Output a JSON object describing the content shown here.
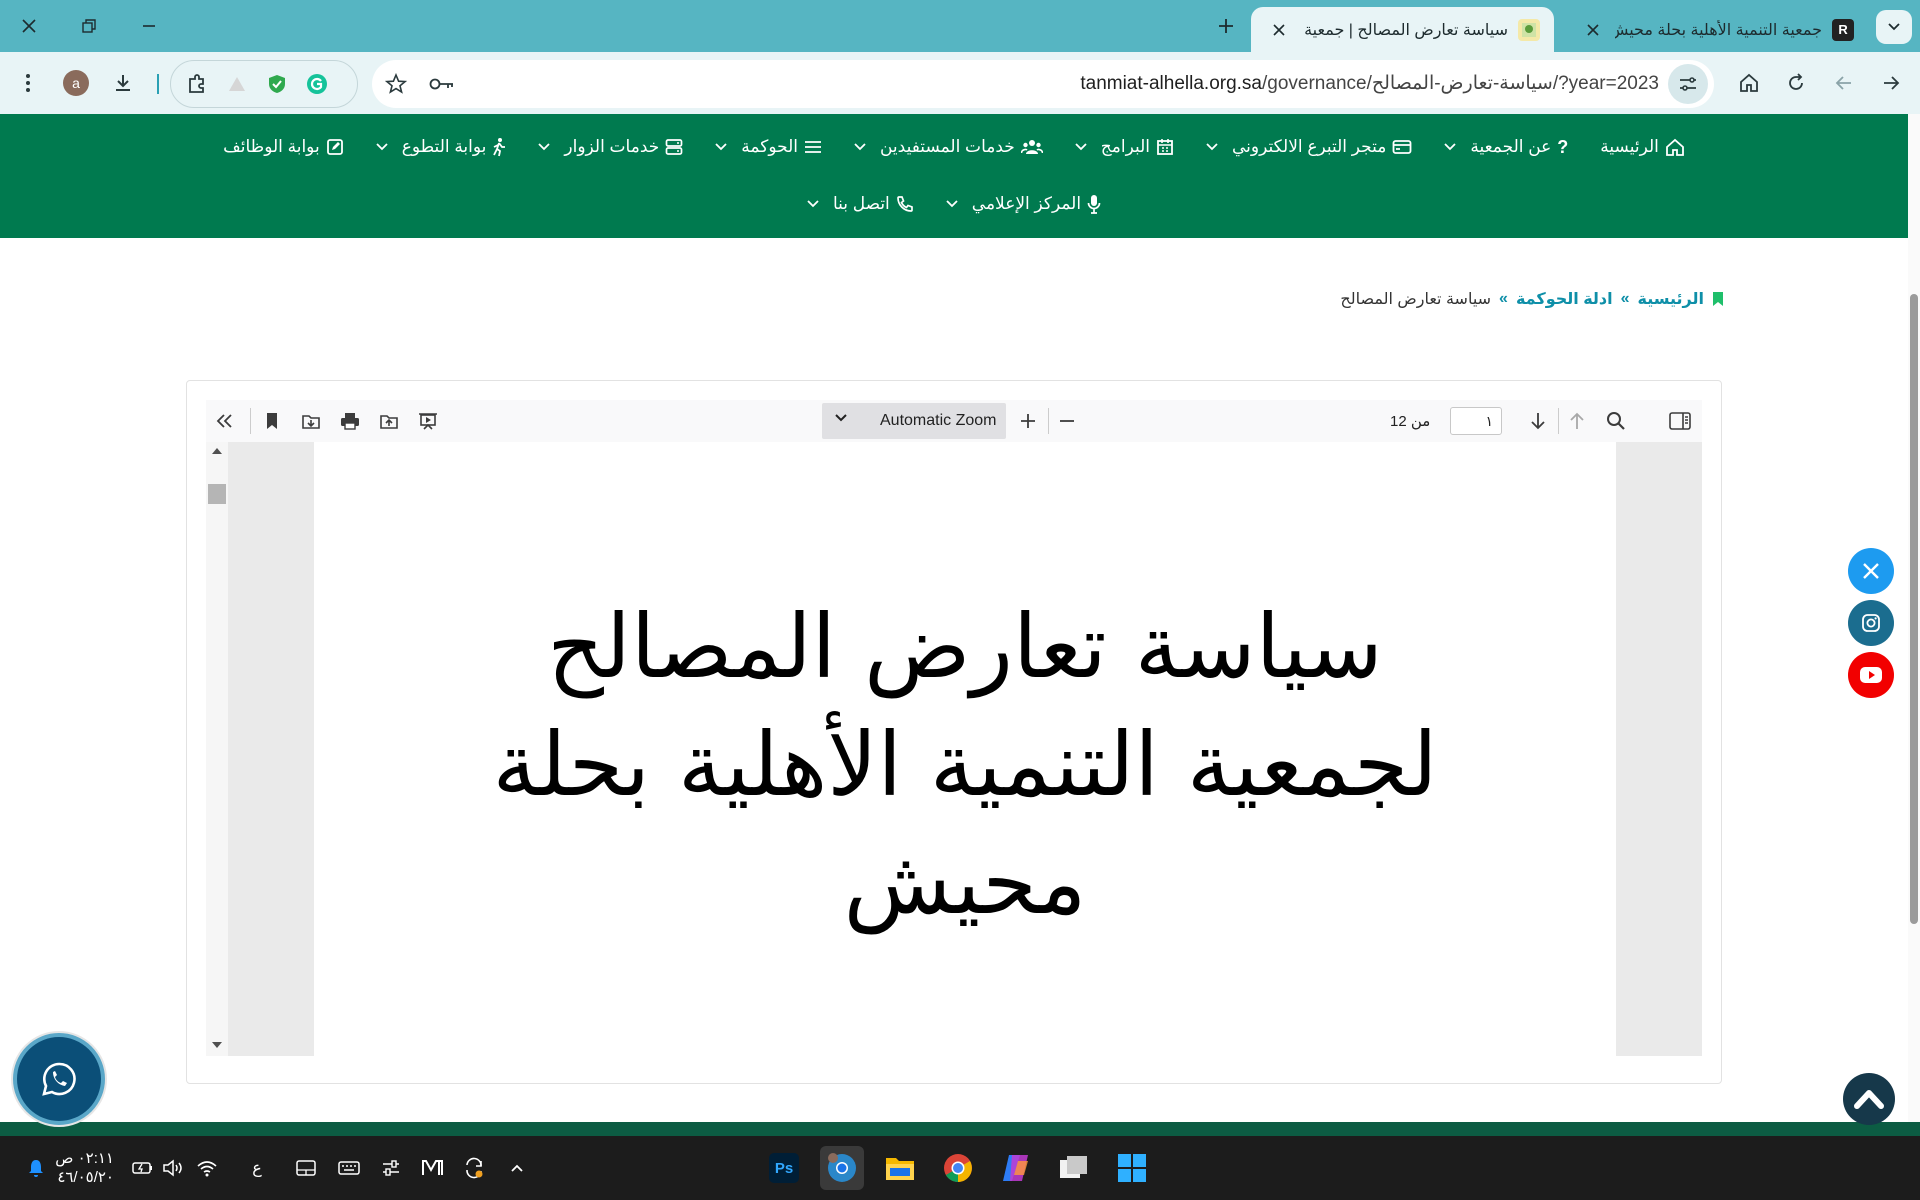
{
  "window": {
    "tabs": [
      {
        "title": "جمعية التنمية الأهلية بحلة محيش",
        "favicon_letter": "R",
        "active": false
      },
      {
        "title": "سياسة تعارض المصالح | جمعية التنمية",
        "active": true
      }
    ]
  },
  "toolbar": {
    "url_host": "tanmiat-alhella.org.sa",
    "url_path": "/governance/سياسة-تعارض-المصالح/?year=2023",
    "profile_letter": "a"
  },
  "nav": {
    "row1": [
      {
        "label": "الرئيسية",
        "icon": "home-icon",
        "dropdown": false
      },
      {
        "label": "عن الجمعية",
        "icon": "question-icon",
        "dropdown": true
      },
      {
        "label": "متجر التبرع الالكتروني",
        "icon": "card-icon",
        "dropdown": true
      },
      {
        "label": "البرامج",
        "icon": "calendar-icon",
        "dropdown": true
      },
      {
        "label": "خدمات المستفيدين",
        "icon": "users-icon",
        "dropdown": true
      },
      {
        "label": "الحوكمة",
        "icon": "list-icon",
        "dropdown": true
      },
      {
        "label": "خدمات الزوار",
        "icon": "server-icon",
        "dropdown": true
      },
      {
        "label": "بوابة التطوع",
        "icon": "person-walking-icon",
        "dropdown": true
      },
      {
        "label": "بوابة الوظائف",
        "icon": "edit-icon",
        "dropdown": false
      }
    ],
    "row2": [
      {
        "label": "المركز الإعلامي",
        "icon": "microphone-icon",
        "dropdown": true
      },
      {
        "label": "اتصل بنا",
        "icon": "phone-icon",
        "dropdown": true
      }
    ]
  },
  "breadcrumb": {
    "home": "الرئيسية",
    "section": "ادلة الحوكمة",
    "current": "سياسة تعارض المصالح",
    "separator": "»"
  },
  "pdf": {
    "zoom": "Automatic Zoom",
    "page_current": "١",
    "page_of_label": "من 12",
    "title_line1": "سياسة تعارض المصالح",
    "title_line2": "لجمعية التنمية الأهلية بحلة",
    "title_line3": "محيش"
  },
  "social": [
    "x-icon",
    "instagram-icon",
    "youtube-icon"
  ],
  "taskbar": {
    "time": "٠٢:١١ ص",
    "date": "٤٦/٠٥/٢٠",
    "lang": "ع",
    "apps": [
      "photoshop-icon",
      "chrome-profile-icon",
      "file-explorer-icon",
      "chrome-icon",
      "copilot-icon",
      "task-view-icon",
      "windows-start-icon"
    ]
  },
  "colors": {
    "tabstrip": "#56b5c2",
    "nav_green": "#007a4f",
    "link_teal": "#0e8fa8"
  }
}
